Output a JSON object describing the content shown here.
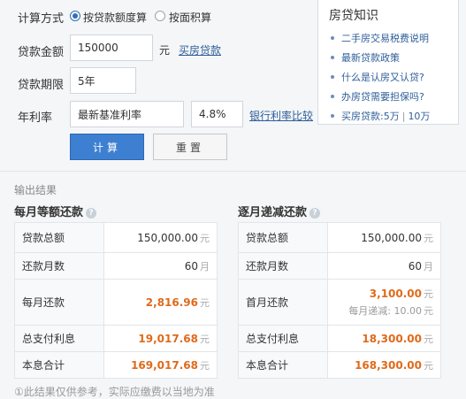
{
  "calc_method": {
    "label": "计算方式",
    "options": [
      {
        "label": "按贷款额度算",
        "selected": true
      },
      {
        "label": "按面积算",
        "selected": false
      }
    ]
  },
  "loan_amount": {
    "label": "贷款金额",
    "value": "150000",
    "unit": "元",
    "link": "买房贷款"
  },
  "loan_term": {
    "label": "贷款期限",
    "value": "5年"
  },
  "rate": {
    "label": "年利率",
    "type_value": "最新基准利率",
    "value": "4.8%",
    "link": "银行利率比较"
  },
  "buttons": {
    "calc": "计算",
    "reset": "重置"
  },
  "knowledge": {
    "title": "房贷知识",
    "items": [
      "二手房交易税费说明",
      "最新贷款政策",
      "什么是认房又认贷?",
      "办房贷需要担保吗?"
    ],
    "last_item": {
      "prefix": "买房贷款:",
      "a": "5万",
      "sep": "|",
      "b": "10万"
    }
  },
  "output": {
    "title": "输出结果",
    "equal_payment": {
      "title": "每月等额还款",
      "rows": {
        "total_loan": {
          "label": "贷款总额",
          "value": "150,000.00",
          "unit": "元"
        },
        "months": {
          "label": "还款月数",
          "value": "60",
          "unit": "月"
        },
        "monthly": {
          "label": "每月还款",
          "value": "2,816.96",
          "unit": "元"
        },
        "interest": {
          "label": "总支付利息",
          "value": "19,017.68",
          "unit": "元"
        },
        "total": {
          "label": "本息合计",
          "value": "169,017.68",
          "unit": "元"
        }
      }
    },
    "decreasing_payment": {
      "title": "逐月递减还款",
      "rows": {
        "total_loan": {
          "label": "贷款总额",
          "value": "150,000.00",
          "unit": "元"
        },
        "months": {
          "label": "还款月数",
          "value": "60",
          "unit": "月"
        },
        "first_month": {
          "label": "首月还款",
          "value": "3,100.00",
          "unit": "元",
          "sub_label": "每月递减:",
          "sub_value": "10.00",
          "sub_unit": "元"
        },
        "interest": {
          "label": "总支付利息",
          "value": "18,300.00",
          "unit": "元"
        },
        "total": {
          "label": "本息合计",
          "value": "168,300.00",
          "unit": "元"
        }
      }
    }
  },
  "footer_note": "①此结果仅供参考，实际应缴费以当地为准"
}
